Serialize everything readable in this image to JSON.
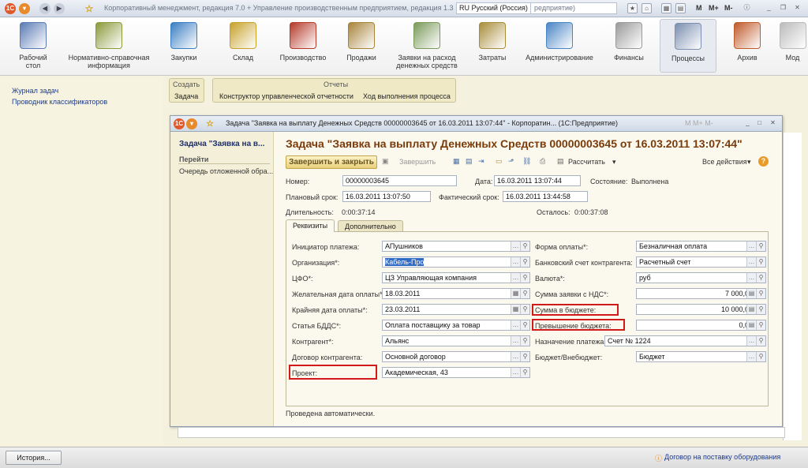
{
  "titlebar": {
    "text": "Корпоративный менеджмент, редакция 7.0 + Управление производственным предприятием, редакция 1.3",
    "lang": "RU Русский (Россия)",
    "search": "редприятие)",
    "mem": [
      "M",
      "M+",
      "M-"
    ]
  },
  "toolbar": [
    {
      "label": "Рабочий стол",
      "color": "#5a7bb5"
    },
    {
      "label": "Нормативно-справочная информация",
      "color": "#8c9a3a"
    },
    {
      "label": "Закупки",
      "color": "#3a7ec2"
    },
    {
      "label": "Склад",
      "color": "#c7a22a"
    },
    {
      "label": "Производство",
      "color": "#b53a2a"
    },
    {
      "label": "Продажи",
      "color": "#a8843a"
    },
    {
      "label": "Заявки на расход денежных средств",
      "color": "#7b9a5a"
    },
    {
      "label": "Затраты",
      "color": "#a98d3a"
    },
    {
      "label": "Администрирование",
      "color": "#4a86c5"
    },
    {
      "label": "Финансы",
      "color": "#9a9a9a"
    },
    {
      "label": "Процессы",
      "color": "#7b8fb0"
    },
    {
      "label": "Архив",
      "color": "#c05a2a"
    },
    {
      "label": "Мод",
      "color": "#bbbbbb"
    }
  ],
  "sidebar": {
    "links": [
      "Журнал задач",
      "Проводник классификаторов"
    ]
  },
  "groups": {
    "create_head": "Создать",
    "create_item": "Задача",
    "reports_head": "Отчеты",
    "report1": "Конструктор управленческой отчетности",
    "report2": "Ход выполнения процесса"
  },
  "window": {
    "title": "Задача \"Заявка на выплату Денежных Средств  00000003645 от 16.03.2011 13:07:44\" - Корпоратин... (1С:Предприятие)",
    "mem": "M  M+  M-",
    "nav_title": "Задача \"Заявка на в...",
    "nav_go": "Перейти",
    "nav_item": "Очередь отложенной обра...",
    "heading": "Задача \"Заявка на выплату Денежных Средств  00000003645 от 16.03.2011 13:07:44\"",
    "btn_finish_close": "Завершить и закрыть",
    "btn_finish": "Завершить",
    "btn_calc": "Рассчитать",
    "btn_all": "Все действия",
    "footer": "Проведена автоматически."
  },
  "header": {
    "num_label": "Номер:",
    "num": "00000003645",
    "date_label": "Дата:",
    "date": "16.03.2011 13:07:44",
    "state_label": "Состояние:",
    "state": "Выполнена",
    "plan_label": "Плановый срок:",
    "plan": "16.03.2011 13:07:50",
    "fact_label": "Фактический срок:",
    "fact": "16.03.2011 13:44:58",
    "dur_label": "Длительность:",
    "dur": "0:00:37:14",
    "left_label": "Осталось:",
    "left": "0:00:37:08"
  },
  "tabs": [
    "Реквизиты",
    "Дополнительно"
  ],
  "left_fields": [
    {
      "label": "Инициатор платежа:",
      "value": "АПушников"
    },
    {
      "label": "Организация*:",
      "value": "Кабель-Про"
    },
    {
      "label": "ЦФО*:",
      "value": "ЦЗ Управляющая компания"
    },
    {
      "label": "Желательная дата оплаты*:",
      "value": "18.03.2011"
    },
    {
      "label": "Крайняя дата оплаты*:",
      "value": "23.03.2011"
    },
    {
      "label": "Статья БДДС*:",
      "value": "Оплата поставщику за товар"
    },
    {
      "label": "Контрагент*:",
      "value": "Альянс"
    },
    {
      "label": "Договор контрагента:",
      "value": "Основной договор"
    },
    {
      "label": "Проект:",
      "value": "Академическая, 43"
    }
  ],
  "right_fields": [
    {
      "label": "Форма оплаты*:",
      "value": "Безналичная оплата"
    },
    {
      "label": "Банковский счет контрагента:",
      "value": "Расчетный счет"
    },
    {
      "label": "Валюта*:",
      "value": "руб"
    },
    {
      "label": "Сумма заявки с НДС*:",
      "value": "7 000,00"
    },
    {
      "label": "Сумма в бюджете:",
      "value": "10 000,00"
    },
    {
      "label": "Превышение бюджета:",
      "value": "0,00"
    },
    {
      "label": "Назначение платежа:",
      "value": "Счет № 1224"
    },
    {
      "label": "Бюджет/Внебюджет:",
      "value": "Бюджет"
    }
  ],
  "status": {
    "history": "История...",
    "link": "Договор на поставку оборудования"
  }
}
